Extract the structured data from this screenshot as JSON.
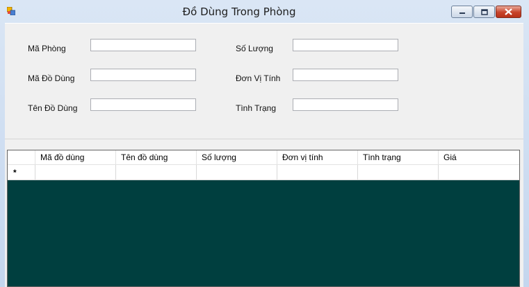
{
  "window": {
    "title": "Đồ Dùng Trong Phòng",
    "icons": {
      "app": "app-icon",
      "minimize": "minimize-icon",
      "maximize": "maximize-icon",
      "close": "close-icon"
    }
  },
  "form": {
    "ma_phong_label": "Mã Phòng",
    "ma_do_dung_label": "Mã Đồ Dùng",
    "ten_do_dung_label": "Tên Đồ Dùng",
    "so_luong_label": "Số Lượng",
    "don_vi_tinh_label": "Đơn Vị Tính",
    "tinh_trang_label": "Tình Trạng",
    "values": {
      "ma_phong": "",
      "ma_do_dung": "",
      "ten_do_dung": "",
      "so_luong": "",
      "don_vi_tinh": "",
      "tinh_trang": ""
    }
  },
  "grid": {
    "columns": [
      "Mã đồ dùng",
      "Tên đồ dùng",
      "Số lượng",
      "Đơn vị tính",
      "Tình trạng",
      "Giá"
    ],
    "new_row_marker": "*",
    "background_color": "#003f3f"
  }
}
